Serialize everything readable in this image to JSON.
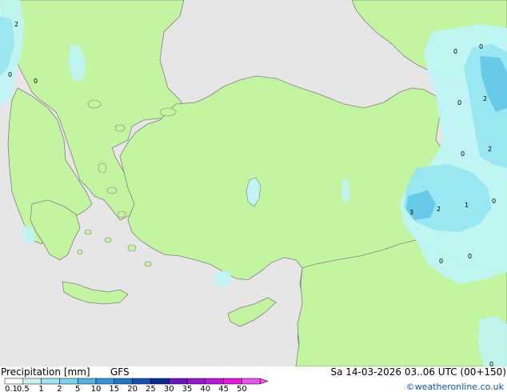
{
  "colors": {
    "sea": "#e6e6e6",
    "land": "#c3f5a0",
    "coast": "#808080",
    "precip_light": "#bff5f5",
    "precip_mid": "#96e6f0",
    "precip_heavy": "#64c8e6",
    "label": "#000000",
    "brand": "#0050c8"
  },
  "map_labels": [
    {
      "id": "2"
    },
    {
      "id": "0"
    },
    {
      "id": "0"
    },
    {
      "id": "0"
    },
    {
      "id": "0"
    },
    {
      "id": "0"
    },
    {
      "id": "2"
    },
    {
      "id": "0"
    },
    {
      "id": "2"
    },
    {
      "id": "0"
    },
    {
      "id": "3"
    },
    {
      "id": "2"
    },
    {
      "id": "1"
    },
    {
      "id": "0"
    },
    {
      "id": "0"
    },
    {
      "id": "0"
    }
  ],
  "legend": {
    "title": "Precipitation [mm]",
    "model": "GFS",
    "valid_time": "Sa 14-03-2026 03..06 UTC (00+150)",
    "credit": "©weatheronline.co.uk",
    "scale": [
      {
        "label": "0.1",
        "color": "#ffffff"
      },
      {
        "label": "0.5",
        "color": "#c8f0f0"
      },
      {
        "label": "1",
        "color": "#a0e6f0"
      },
      {
        "label": "2",
        "color": "#78d2f0"
      },
      {
        "label": "5",
        "color": "#50b4e6"
      },
      {
        "label": "10",
        "color": "#3296dc"
      },
      {
        "label": "15",
        "color": "#1e78c8"
      },
      {
        "label": "20",
        "color": "#1450b4"
      },
      {
        "label": "25",
        "color": "#0a2896"
      },
      {
        "label": "30",
        "color": "#6e14c8"
      },
      {
        "label": "35",
        "color": "#9614d2"
      },
      {
        "label": "40",
        "color": "#be14dc"
      },
      {
        "label": "45",
        "color": "#e614e6"
      },
      {
        "label": "50",
        "color": "#f050f0"
      }
    ]
  }
}
